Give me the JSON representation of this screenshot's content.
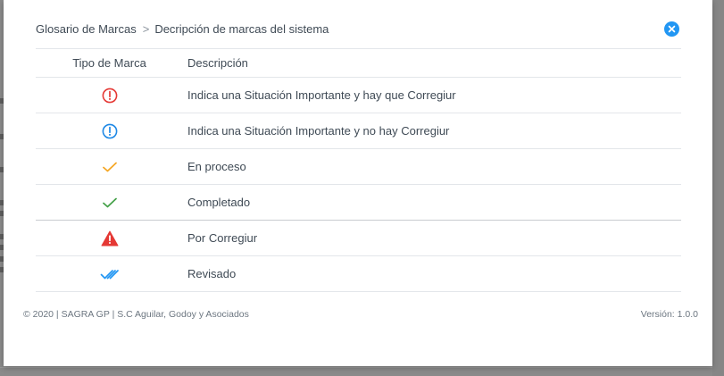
{
  "modal": {
    "breadcrumb": {
      "root": "Glosario de Marcas",
      "separator": ">",
      "current": "Decripción de marcas del sistema"
    },
    "close_icon": "close-circle-icon",
    "table": {
      "headers": {
        "type": "Tipo de Marca",
        "description": "Descripción"
      },
      "rows": [
        {
          "icon": "exclamation-circle-red-icon",
          "color": "#e53935",
          "description": "Indica una Situación Importante y hay que Corregiur"
        },
        {
          "icon": "exclamation-circle-blue-icon",
          "color": "#1e88e5",
          "description": "Indica una Situación Importante y no hay Corregiur"
        },
        {
          "icon": "check-orange-icon",
          "color": "#f5a623",
          "description": "En proceso"
        },
        {
          "icon": "check-green-icon",
          "color": "#43a047",
          "description": "Completado"
        },
        {
          "icon": "warning-triangle-red-icon",
          "color": "#e53935",
          "description": "Por Corregiur"
        },
        {
          "icon": "double-check-blue-icon",
          "color": "#2196f3",
          "description": "Revisado"
        }
      ]
    },
    "footer": {
      "copyright": "© 2020 | SAGRA GP | S.C Aguilar, Godoy y Asociados",
      "version": "Versión: 1.0.0"
    }
  },
  "colors": {
    "accent": "#2196f3",
    "text": "#3f4a55",
    "divider": "#e3e6ea"
  }
}
